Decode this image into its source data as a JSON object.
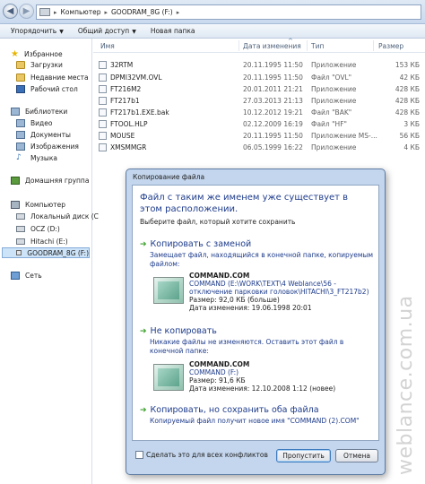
{
  "address": {
    "path": [
      "Компьютер",
      "GOODRAM_8G (F:)"
    ]
  },
  "toolbar": {
    "organize": "Упорядочить",
    "share": "Общий доступ",
    "new_folder": "Новая папка"
  },
  "nav": {
    "favorites": "Избранное",
    "downloads": "Загрузки",
    "recent": "Недавние места",
    "desktop": "Рабочий стол",
    "libraries": "Библиотеки",
    "video": "Видео",
    "documents": "Документы",
    "images": "Изображения",
    "music": "Музыка",
    "homegroup": "Домашняя группа",
    "computer": "Компьютер",
    "local_disk": "Локальный диск (C",
    "ocz": "OCZ (D:)",
    "hitachi": "Hitachi (E:)",
    "goodram": "GOODRAM_8G (F:)",
    "network": "Сеть"
  },
  "columns": {
    "name": "Имя",
    "date": "Дата изменения",
    "type": "Тип",
    "size": "Размер"
  },
  "files": [
    {
      "name": "32RTM",
      "date": "20.11.1995 11:50",
      "type": "Приложение",
      "size": "153 КБ"
    },
    {
      "name": "DPMI32VM.OVL",
      "date": "20.11.1995 11:50",
      "type": "Файл \"OVL\"",
      "size": "42 КБ"
    },
    {
      "name": "FT216M2",
      "date": "20.01.2011 21:21",
      "type": "Приложение",
      "size": "428 КБ"
    },
    {
      "name": "FT217b1",
      "date": "27.03.2013 21:13",
      "type": "Приложение",
      "size": "428 КБ"
    },
    {
      "name": "FT217b1.EXE.bak",
      "date": "10.12.2012 19:21",
      "type": "Файл \"BAK\"",
      "size": "428 КБ"
    },
    {
      "name": "FTOOL.HLP",
      "date": "02.12.2009 16:19",
      "type": "Файл \"HF\"",
      "size": "3 КБ"
    },
    {
      "name": "MOUSE",
      "date": "20.11.1995 11:50",
      "type": "Приложение MS-...",
      "size": "56 КБ"
    },
    {
      "name": "XMSMMGR",
      "date": "06.05.1999 16:22",
      "type": "Приложение",
      "size": "4 КБ"
    }
  ],
  "dialog": {
    "title": "Копирование файла",
    "heading": "Файл с таким же именем уже существует в этом расположении.",
    "subtitle": "Выберите файл, который хотите сохранить",
    "replace": {
      "title": "Копировать с заменой",
      "desc": "Замещает файл, находящийся в конечной папке, копируемым файлом:",
      "file_name": "COMMAND.COM",
      "file_path": "COMMAND (E:\\WORK\\TEXT\\4 Weblance\\56 - отключение парковки головок\\HITACHI\\3_FT217b2)",
      "file_size": "Размер: 92,0 КБ (больше)",
      "file_date": "Дата изменения: 19.06.1998 20:01"
    },
    "skip": {
      "title": "Не копировать",
      "desc": "Никакие файлы не изменяются. Оставить этот файл в конечной папке:",
      "file_name": "COMMAND.COM",
      "file_path": "COMMAND (F:)",
      "file_size": "Размер: 91,6 КБ",
      "file_date": "Дата изменения: 12.10.2008 1:12 (новее)"
    },
    "keep_both": {
      "title": "Копировать, но сохранить оба файла",
      "desc": "Копируемый файл получит новое имя \"COMMAND (2).COM\""
    },
    "checkbox_label": "Сделать это для всех конфликтов",
    "skip_button": "Пропустить",
    "cancel_button": "Отмена"
  },
  "watermark": "weblance.com.ua"
}
